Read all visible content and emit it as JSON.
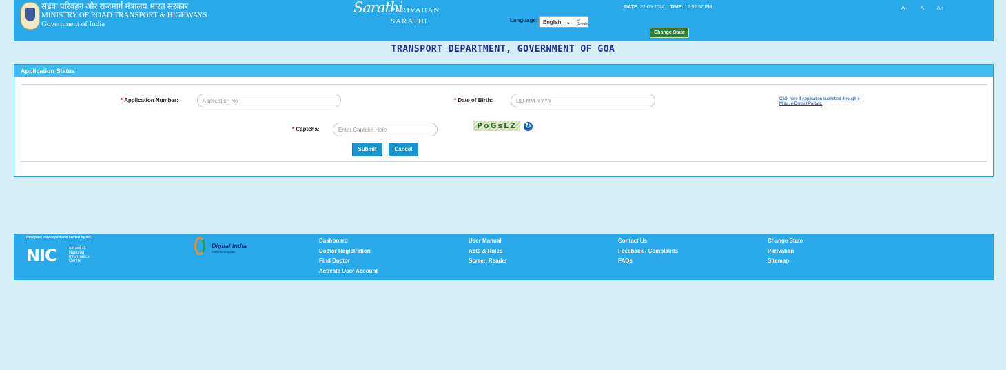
{
  "header": {
    "ministry_hindi": "सड़क परिवहन और राजमार्ग मंत्रालय भारत सरकार",
    "ministry_english": "MINISTRY OF ROAD TRANSPORT & HIGHWAYS",
    "government": "Government of India",
    "logo_text": "Sarathi",
    "brand_line1": "PARIVAHAN",
    "brand_line2": "SARATHI",
    "date_label": "DATE:",
    "date_value": "22-05-2024",
    "time_label": "TIME:",
    "time_value": "12:32:57 PM",
    "font_controls": [
      "A-",
      "A",
      "A+"
    ],
    "language_label": "Language:",
    "language_value": "English",
    "language_by": "by Google",
    "change_state": "Change State"
  },
  "department_title": "TRANSPORT DEPARTMENT, GOVERNMENT OF GOA",
  "panel": {
    "title": "Application Status",
    "application_number_label": "Application Number:",
    "application_number_placeholder": "Application No",
    "dob_label": "Date of Birth:",
    "dob_placeholder": "DD-MM-YYYY",
    "help_link": "Click here if Application submitted through e-Mitra, e-District Portals.",
    "captcha_label": "Captcha:",
    "captcha_placeholder": "Enter Captcha Here",
    "captcha_text": "PoGsLZ",
    "required_mark": "*",
    "submit": "Submit",
    "cancel": "Cancel"
  },
  "footer": {
    "designed_by": "Designed, developed and hosted by NIC",
    "nic_logo": "NIC",
    "nic_hindi": "एन.आई.सी",
    "nic_lines": [
      "National",
      "Informatics",
      "Centre"
    ],
    "digital_india": "Digital India",
    "digital_india_tagline": "Power To Empower",
    "columns": [
      [
        "Dashboard",
        "Doctor Registration",
        "Find Doctor",
        "Activate User Account"
      ],
      [
        "User Manual",
        "Acts & Rules",
        "Screen Reader"
      ],
      [
        "Contact Us",
        "Feedback / Complaints",
        "FAQs"
      ],
      [
        "Change State",
        "Parivahan",
        "Sitemap"
      ]
    ]
  },
  "colors": {
    "header_bg": "#29a8ea",
    "panel_header_bg": "#3fbdf2",
    "page_bg": "#d6eef6",
    "title_color": "#1a2fa0",
    "button_bg": "#1796d1",
    "change_state_bg": "#2e7d32"
  }
}
